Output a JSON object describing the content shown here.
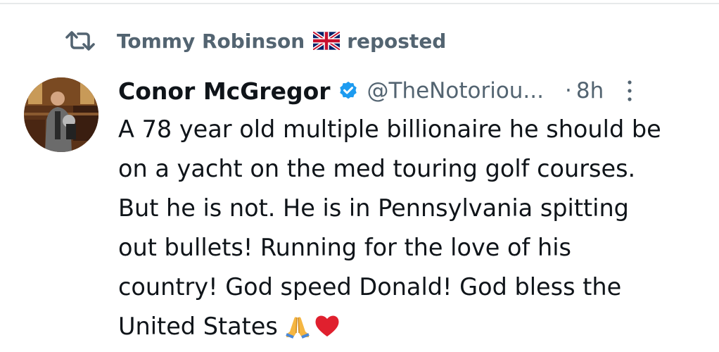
{
  "repost": {
    "reposter_name": "Tommy Robinson",
    "reposter_flag_icon": "uk-flag-icon",
    "reposted_label": "reposted"
  },
  "tweet": {
    "author_name": "Conor McGregor",
    "verified": true,
    "handle": "@TheNotoriou...",
    "dot": "·",
    "time": "8h",
    "text_lines": [
      "A 78 year old multiple billionaire he should be",
      "on a yacht on the med touring golf courses.",
      "But he is not. He is in Pennsylvania spitting",
      "out bullets! Running for the love of his",
      "country! God speed Donald! God bless the",
      "United States"
    ],
    "trailing_emojis": [
      "folded-hands-emoji",
      "red-heart-emoji"
    ]
  },
  "colors": {
    "text_primary": "#0f1419",
    "text_secondary": "#536471",
    "verified_blue": "#1d9bf0",
    "heart_red": "#e0202e"
  }
}
